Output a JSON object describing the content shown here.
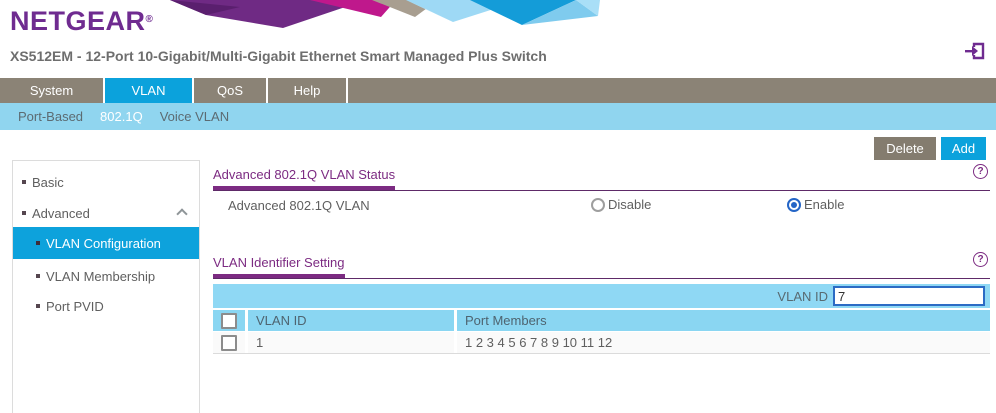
{
  "brand": {
    "logo": "NETGEAR",
    "registered": "®"
  },
  "header": {
    "title": "XS512EM - 12-Port 10-Gigabit/Multi-Gigabit Ethernet Smart Managed Plus Switch"
  },
  "nav": {
    "tabs": [
      {
        "label": "System",
        "active": false
      },
      {
        "label": "VLAN",
        "active": true
      },
      {
        "label": "QoS",
        "active": false
      },
      {
        "label": "Help",
        "active": false
      }
    ]
  },
  "subnav": {
    "items": [
      {
        "label": "Port-Based",
        "active": false
      },
      {
        "label": "802.1Q",
        "active": true
      },
      {
        "label": "Voice VLAN",
        "active": false
      }
    ]
  },
  "actions": {
    "delete_label": "Delete",
    "add_label": "Add"
  },
  "sidebar": {
    "items": [
      {
        "label": "Basic",
        "level": 1,
        "active": false
      },
      {
        "label": "Advanced",
        "level": 1,
        "active": false,
        "expanded": true
      },
      {
        "label": "VLAN Configuration",
        "level": 2,
        "active": true
      },
      {
        "label": "VLAN Membership",
        "level": 2,
        "active": false
      },
      {
        "label": "Port PVID",
        "level": 2,
        "active": false
      }
    ]
  },
  "status_section": {
    "heading": "Advanced 802.1Q VLAN Status",
    "help_icon": "?",
    "field_label": "Advanced 802.1Q VLAN",
    "options": [
      {
        "label": "Disable",
        "selected": false
      },
      {
        "label": "Enable",
        "selected": true
      }
    ]
  },
  "identifier_section": {
    "heading": "VLAN Identifier Setting",
    "help_icon": "?",
    "vlan_id_label": "VLAN ID",
    "vlan_id_value": "7",
    "table": {
      "columns": [
        "VLAN ID",
        "Port Members"
      ],
      "rows": [
        {
          "vlan_id": "1",
          "port_members": "1 2 3 4 5 6 7 8 9 10 11 12"
        }
      ]
    }
  },
  "colors": {
    "brand_purple": "#6F2B90",
    "heading_purple": "#7C2B82",
    "accent_blue": "#0BA2DC",
    "subnav_blue": "#90D5EF",
    "table_header_blue": "#8AD6F2",
    "nav_gray": "#8B8376",
    "delete_gray": "#847C6F",
    "text_gray": "#5F5F5F",
    "input_focus_blue": "#2B6BC4",
    "radio_selected_blue": "#2465C6"
  }
}
